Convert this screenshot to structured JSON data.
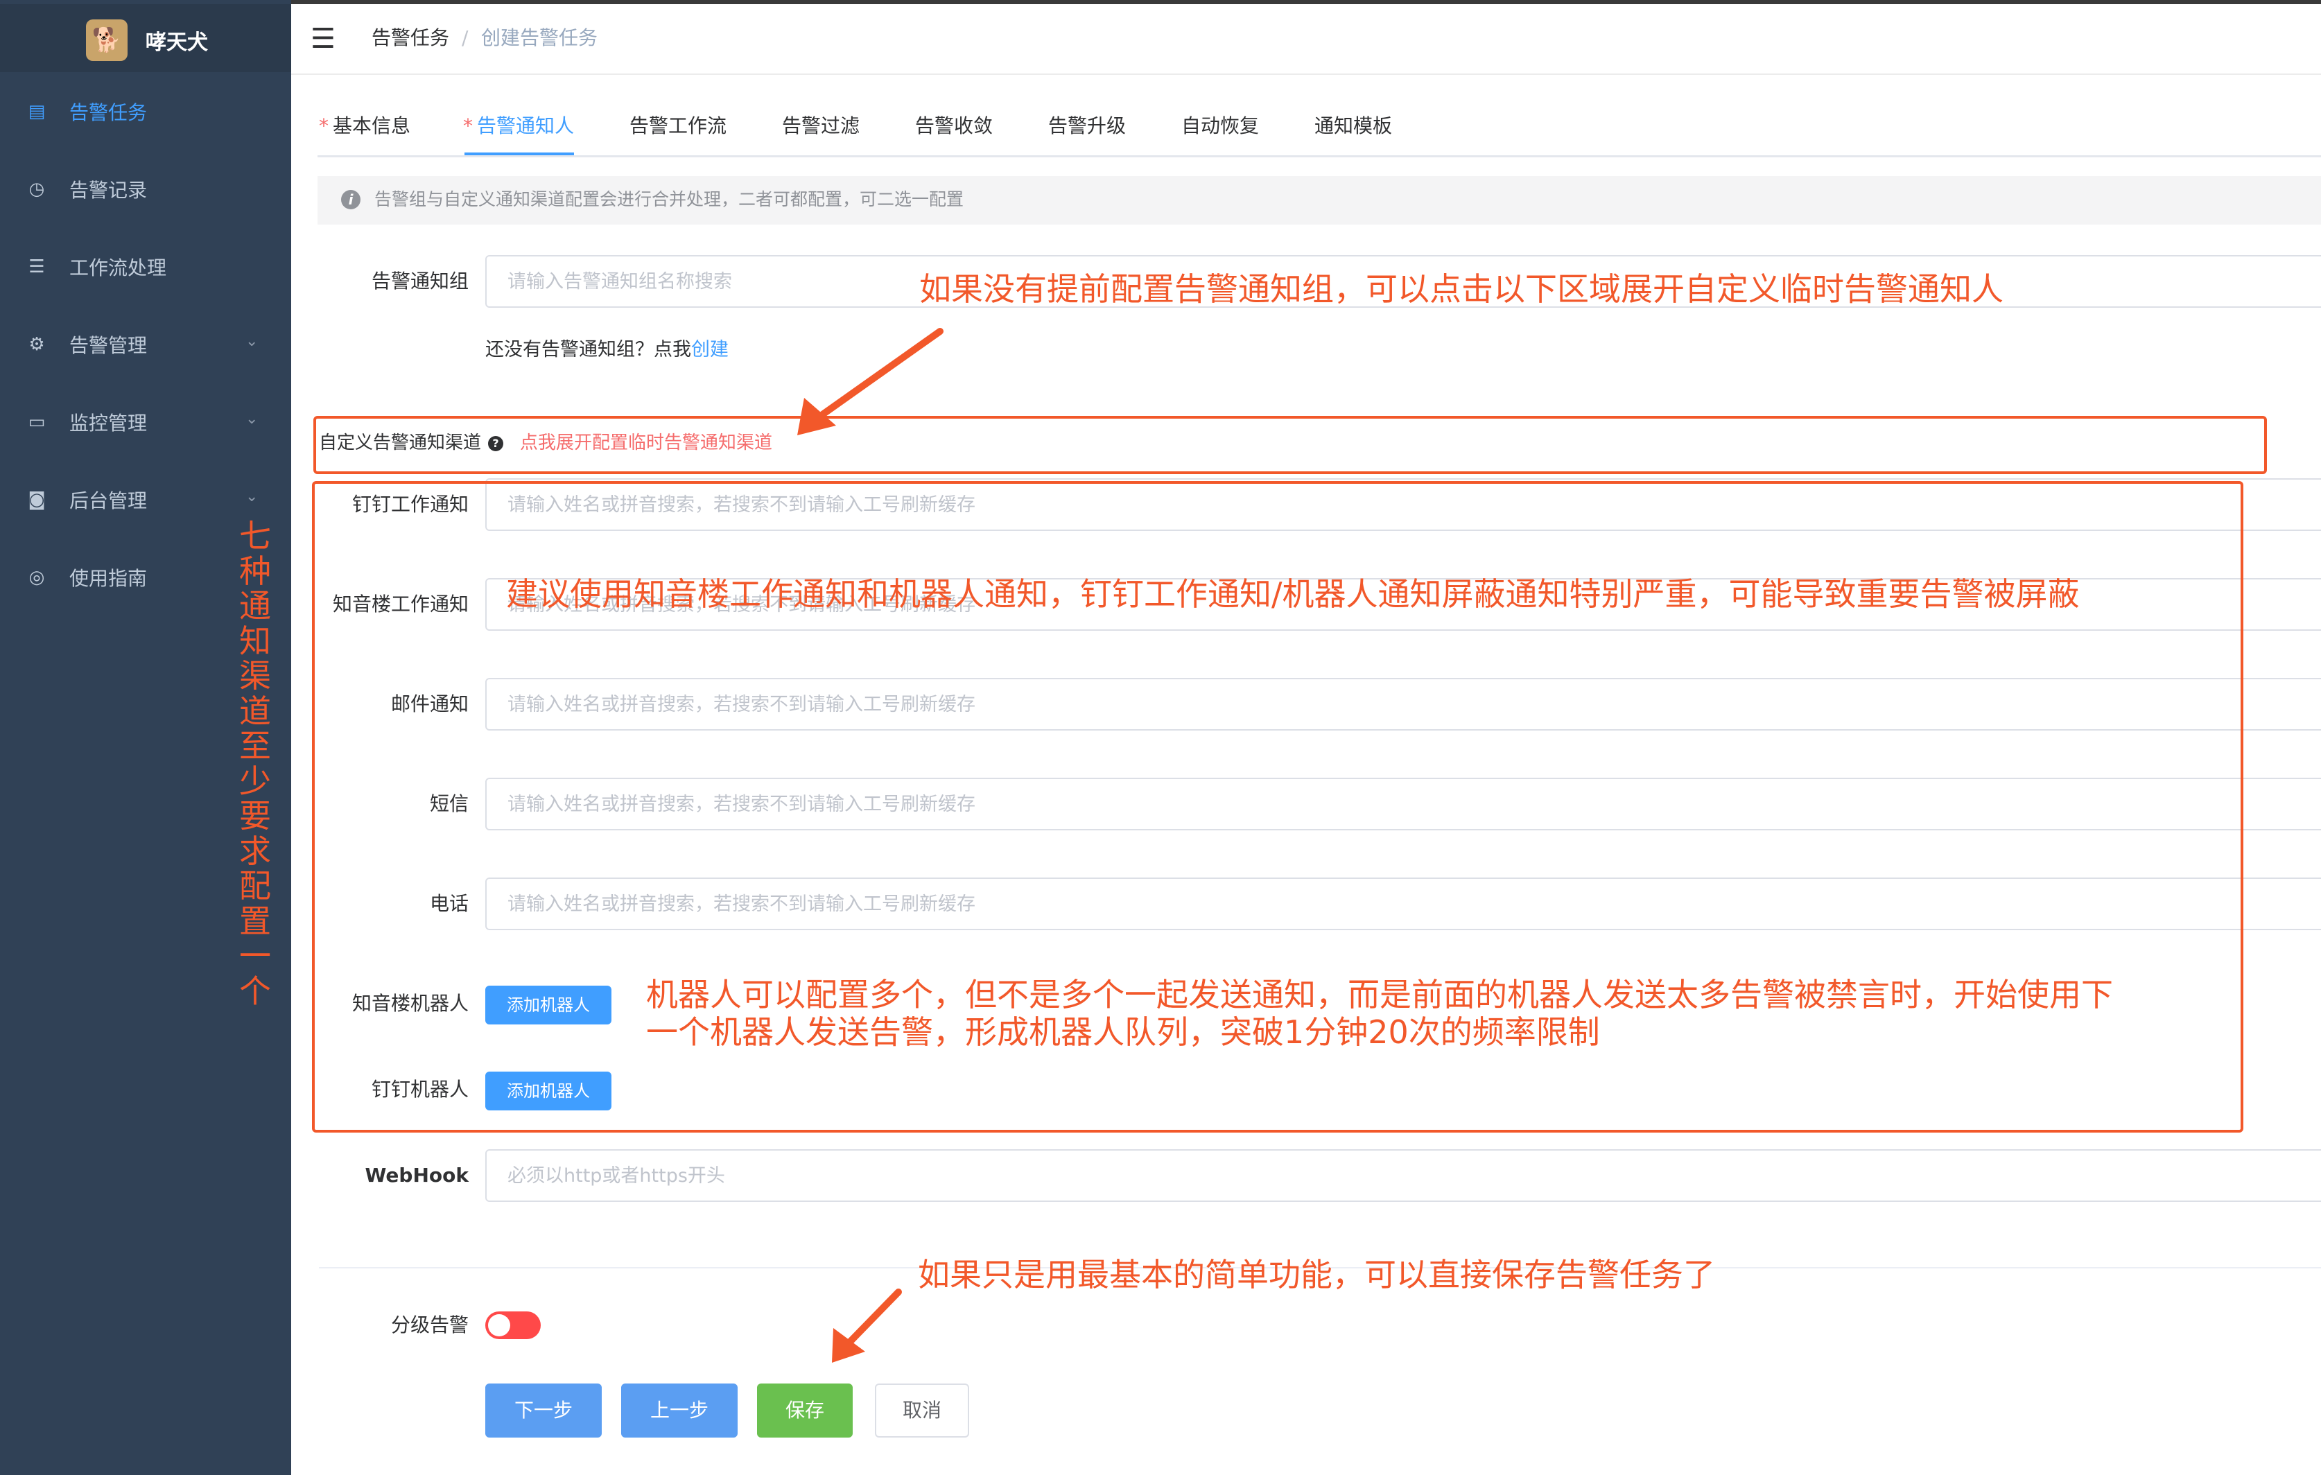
{
  "app": {
    "logo_text": "哮天犬"
  },
  "sidebar": {
    "items": [
      {
        "label": "告警任务",
        "icon": "document-icon",
        "glyph": "▤",
        "active": true
      },
      {
        "label": "告警记录",
        "icon": "clock-icon",
        "glyph": "◷",
        "active": false
      },
      {
        "label": "工作流处理",
        "icon": "workflow-icon",
        "glyph": "☰",
        "active": false
      },
      {
        "label": "告警管理",
        "icon": "nodes-icon",
        "glyph": "⚙",
        "active": false,
        "expandable": true
      },
      {
        "label": "监控管理",
        "icon": "monitor-icon",
        "glyph": "▭",
        "active": false,
        "expandable": true
      },
      {
        "label": "后台管理",
        "icon": "admin-icon",
        "glyph": "◙",
        "active": false,
        "expandable": true
      },
      {
        "label": "使用指南",
        "icon": "compass-icon",
        "glyph": "◎",
        "active": false
      }
    ],
    "arrow_glyph": "⌄"
  },
  "header": {
    "menu_glyph": "☰",
    "breadcrumb": [
      "告警任务",
      "创建告警任务"
    ],
    "separator": "/"
  },
  "tabs": [
    {
      "label": "基本信息",
      "required": true,
      "active": false
    },
    {
      "label": "告警通知人",
      "required": true,
      "active": true
    },
    {
      "label": "告警工作流",
      "required": false,
      "active": false
    },
    {
      "label": "告警过滤",
      "required": false,
      "active": false
    },
    {
      "label": "告警收敛",
      "required": false,
      "active": false
    },
    {
      "label": "告警升级",
      "required": false,
      "active": false
    },
    {
      "label": "自动恢复",
      "required": false,
      "active": false
    },
    {
      "label": "通知模板",
      "required": false,
      "active": false
    }
  ],
  "required_mark": "*",
  "alert": {
    "icon_glyph": "i",
    "text": "告警组与自定义通知渠道配置会进行合并处理，二者可都配置，可二选一配置"
  },
  "form": {
    "group": {
      "label": "告警通知组",
      "placeholder": "请输入告警通知组名称搜索"
    },
    "hint": {
      "text": "还没有告警通知组？点我",
      "link": "创建"
    },
    "custom": {
      "title": "自定义告警通知渠道",
      "help_glyph": "?",
      "expand_link": "点我展开配置临时告警通知渠道"
    },
    "dingtalk_work": {
      "label": "钉钉工作通知",
      "placeholder": "请输入姓名或拼音搜索，若搜索不到请输入工号刷新缓存"
    },
    "zhiyinlou_work": {
      "label": "知音楼工作通知",
      "placeholder": "请输入姓名或拼音搜索，若搜索不到请输入工号刷新缓存"
    },
    "email": {
      "label": "邮件通知",
      "placeholder": "请输入姓名或拼音搜索，若搜索不到请输入工号刷新缓存"
    },
    "sms": {
      "label": "短信",
      "placeholder": "请输入姓名或拼音搜索，若搜索不到请输入工号刷新缓存"
    },
    "phone": {
      "label": "电话",
      "placeholder": "请输入姓名或拼音搜索，若搜索不到请输入工号刷新缓存"
    },
    "zhiyinlou_robot": {
      "label": "知音楼机器人",
      "button": "添加机器人"
    },
    "dingtalk_robot": {
      "label": "钉钉机器人",
      "button": "添加机器人"
    },
    "webhook": {
      "label": "WebHook",
      "placeholder": "必须以http或者https开头"
    },
    "tiered": {
      "label": "分级告警",
      "enabled": false
    }
  },
  "actions": {
    "next": "下一步",
    "prev": "上一步",
    "save": "保存",
    "cancel": "取消"
  },
  "annotations": {
    "group_note": "如果没有提前配置告警通知组，可以点击以下区域展开自定义临时告警通知人",
    "channel_note": "建议使用知音楼工作通知和机器人通知，钉钉工作通知/机器人通知屏蔽通知特别严重，可能导致重要告警被屏蔽",
    "robot_note_line1": "机器人可以配置多个，但不是多个一起发送通知，而是前面的机器人发送太多告警被禁言时，开始使用下",
    "robot_note_line2": "一个机器人发送告警，形成机器人队列，突破1分钟20次的频率限制",
    "save_note": "如果只是用最基本的简单功能，可以直接保存告警任务了",
    "vertical_note": "七种通知渠道至少要求配置一个",
    "color": "#f2582a"
  },
  "colors": {
    "sidebar_bg": "#304156",
    "primary": "#409eff",
    "success": "#6ac04f",
    "danger": "#ff4949"
  }
}
